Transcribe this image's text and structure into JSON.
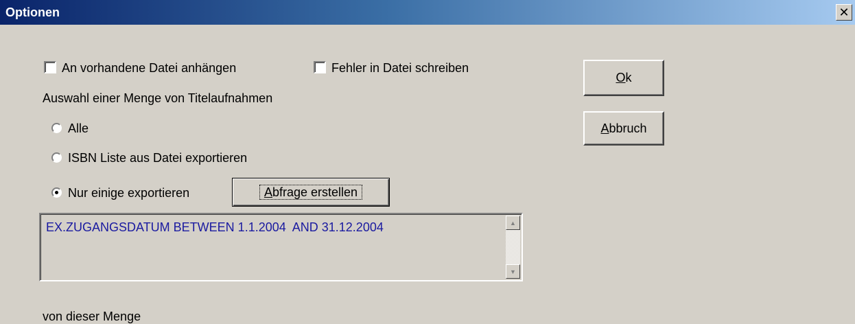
{
  "window": {
    "title": "Optionen",
    "close_glyph": "✕"
  },
  "options": {
    "append_label": "An vorhandene Datei anhängen",
    "errors_label": "Fehler in Datei schreiben"
  },
  "selection": {
    "heading": "Auswahl einer Menge von Titelaufnahmen",
    "radio_all": "Alle",
    "radio_isbn": "ISBN Liste aus Datei exportieren",
    "radio_some": "Nur einige exportieren",
    "selected": "radio_some",
    "query_button": {
      "mnemonic": "A",
      "rest": "bfrage erstellen"
    },
    "query_text": "EX.ZUGANGSDATUM BETWEEN 1.1.2004  AND 31.12.2004"
  },
  "footer": {
    "subset_label": "von dieser Menge"
  },
  "buttons": {
    "ok": {
      "mnemonic": "O",
      "rest": "k"
    },
    "cancel": {
      "mnemonic": "A",
      "rest": "bbruch"
    }
  },
  "colors": {
    "title_start": "#0a246a",
    "title_end": "#a6caf0",
    "query_text": "#1a1aa0",
    "face": "#d4d0c8"
  }
}
